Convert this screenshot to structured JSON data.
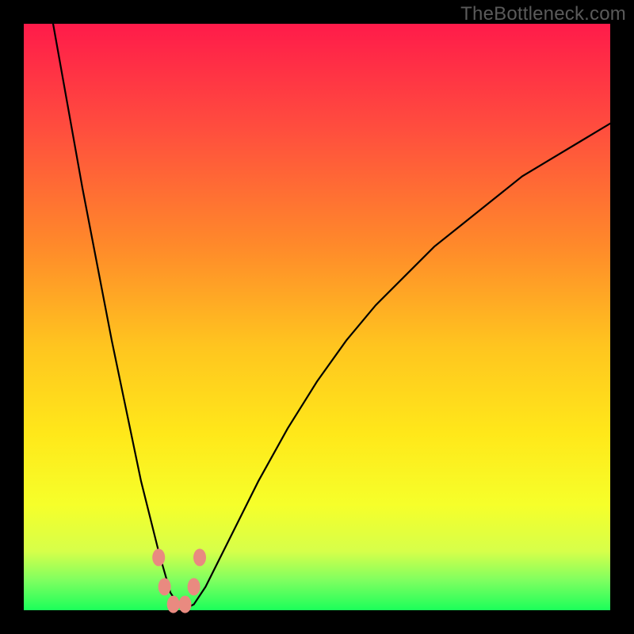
{
  "watermark": "TheBottleneck.com",
  "colors": {
    "frame": "#000000",
    "gradient_top": "#ff1b4a",
    "gradient_mid1": "#ff8a2a",
    "gradient_mid2": "#ffe81a",
    "gradient_bottom": "#1bff5a",
    "curve": "#000000",
    "markers": "#e98a80"
  },
  "chart_data": {
    "type": "line",
    "title": "",
    "xlabel": "",
    "ylabel": "",
    "xlim": [
      0,
      100
    ],
    "ylim": [
      0,
      100
    ],
    "grid": false,
    "legend": false,
    "notes": "V-shaped bottleneck curve; minimum near x≈27, y≈0. Left branch rises steeply to y≈100 at x≈5; right branch rises with decreasing slope to y≈83 at x≈100. Salmon marker dots cluster near the valley bottom.",
    "series": [
      {
        "name": "curve",
        "x": [
          5,
          10,
          15,
          20,
          23,
          25,
          27,
          29,
          31,
          35,
          40,
          45,
          50,
          55,
          60,
          65,
          70,
          75,
          80,
          85,
          90,
          95,
          100
        ],
        "y": [
          100,
          72,
          46,
          22,
          10,
          3,
          0,
          1,
          4,
          12,
          22,
          31,
          39,
          46,
          52,
          57,
          62,
          66,
          70,
          74,
          77,
          80,
          83
        ]
      }
    ],
    "markers": [
      {
        "x": 23,
        "y": 9
      },
      {
        "x": 24,
        "y": 4
      },
      {
        "x": 25.5,
        "y": 1
      },
      {
        "x": 27.5,
        "y": 1
      },
      {
        "x": 29,
        "y": 4
      },
      {
        "x": 30,
        "y": 9
      }
    ]
  }
}
